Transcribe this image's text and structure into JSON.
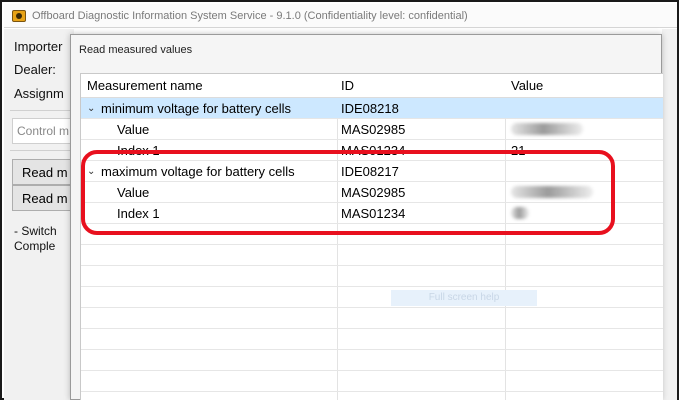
{
  "window": {
    "title": "Offboard Diagnostic Information System Service - 9.1.0 (Confidentiality level: confidential)"
  },
  "background": {
    "labels": [
      "Importer",
      "Dealer:",
      "Assignm"
    ],
    "field_value": "Control m",
    "buttons": [
      "Read m",
      "Read m"
    ],
    "notes": [
      "- Switch",
      "Comple"
    ]
  },
  "dialog": {
    "title": "Read measured values",
    "columns": [
      "Measurement name",
      "ID",
      "Value"
    ],
    "rows": [
      {
        "name": "minimum voltage for battery cells",
        "id": "IDE08218",
        "value": "",
        "group": true,
        "expanded": true,
        "selected": true
      },
      {
        "name": "Value",
        "id": "MAS02985",
        "value": "",
        "group": false,
        "redacted": true
      },
      {
        "name": "Index 1",
        "id": "MAS01234",
        "value": "21",
        "group": false
      },
      {
        "name": "maximum voltage for battery cells",
        "id": "IDE08217",
        "value": "",
        "group": true,
        "expanded": true
      },
      {
        "name": "Value",
        "id": "MAS02985",
        "value": "",
        "group": false,
        "redacted": true
      },
      {
        "name": "Index 1",
        "id": "MAS01234",
        "value": "",
        "group": false,
        "redacted": true
      }
    ],
    "overlay_button": "Full screen help"
  },
  "colors": {
    "selection": "#cde8ff",
    "highlight_ring": "#e8101e",
    "app_icon": "#e8a317"
  },
  "icons": {
    "app": "odis-app-icon",
    "expand": "chevron-down-icon"
  }
}
